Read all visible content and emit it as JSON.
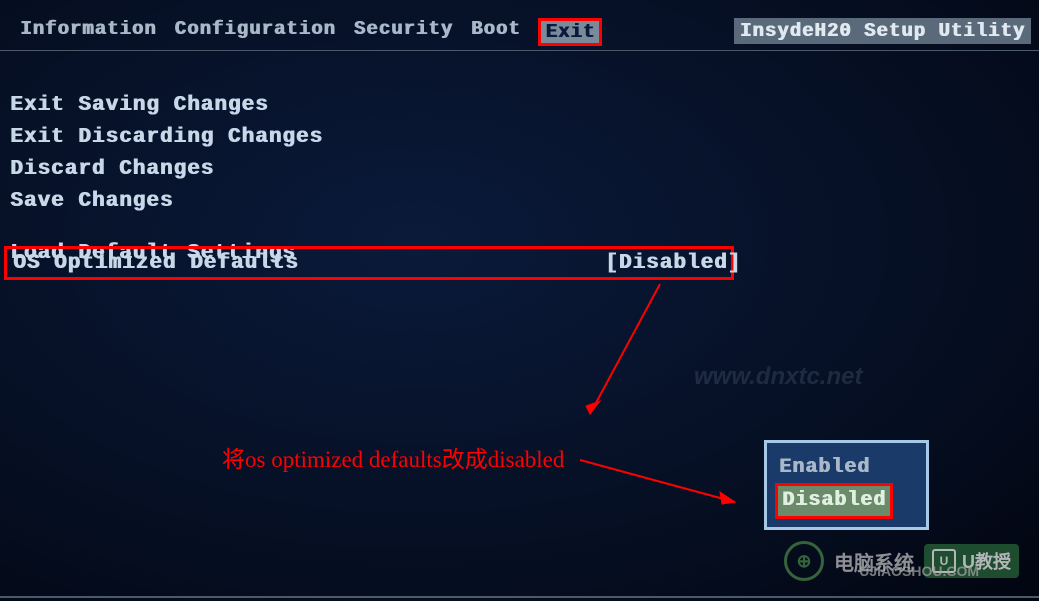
{
  "header": {
    "tabs": [
      "Information",
      "Configuration",
      "Security",
      "Boot",
      "Exit"
    ],
    "active_tab_index": 4,
    "utility_title": "InsydeH20 Setup Utility"
  },
  "menu": {
    "items": [
      "Exit Saving Changes",
      "Exit Discarding Changes",
      "Discard Changes",
      "Save Changes"
    ],
    "items2": [
      "Load Default Settings"
    ]
  },
  "highlighted": {
    "label": "OS Optimized Defaults",
    "value": "[Disabled]"
  },
  "annotation": "将os optimized defaults改成disabled",
  "popup": {
    "options": [
      "Enabled",
      "Disabled"
    ],
    "selected_index": 1
  },
  "watermarks": {
    "wm1": "www.dnxtc.net",
    "wm2_text": "U教授",
    "wm3": "UJIAOSHOU.COM",
    "wm_side": "电脑系统"
  }
}
